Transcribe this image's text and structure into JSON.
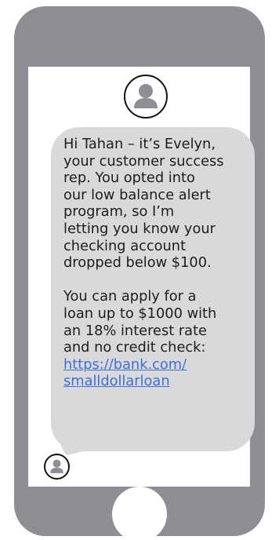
{
  "conversation": {
    "sender_avatar_icon": "person-icon",
    "recipient_avatar_icon": "person-icon",
    "message": {
      "paragraph_1": "Hi Tahan – it’s Evelyn,\nyour customer success\nrep. You opted into\nour low balance alert\nprogram, so I’m\nletting you know your\nchecking account\ndropped below $100.",
      "paragraph_2": "You can apply for a\nloan up to $1000 with\nan 18% interest rate\nand no credit check:",
      "link_text": "https://bank.com/\nsmalldollarloan"
    }
  },
  "colors": {
    "phone_body": "#8d8f95",
    "bubble": "#d9d9db",
    "text": "#1d1d1d",
    "link": "#3f6fd8"
  }
}
